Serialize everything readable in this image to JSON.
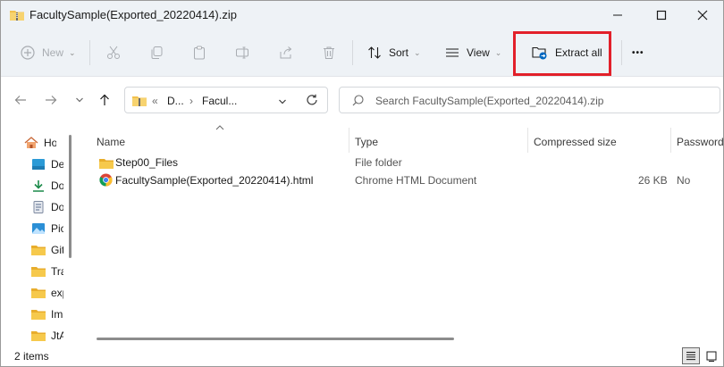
{
  "window": {
    "title": "FacultySample(Exported_20220414).zip"
  },
  "toolbar": {
    "new_label": "New",
    "sort_label": "Sort",
    "view_label": "View",
    "extract_label": "Extract all",
    "more_label": "•••"
  },
  "address": {
    "overflow": "«",
    "crumbs": [
      "D...",
      "Facul..."
    ]
  },
  "search": {
    "placeholder": "Search FacultySample(Exported_20220414).zip"
  },
  "sidebar": {
    "items": [
      {
        "label": "Home",
        "icon": "home-icon"
      },
      {
        "label": "Desktop",
        "icon": "desktop-icon"
      },
      {
        "label": "Downloads",
        "icon": "download-icon"
      },
      {
        "label": "Documents",
        "icon": "document-icon"
      },
      {
        "label": "Pictures",
        "icon": "pictures-icon"
      },
      {
        "label": "GitHub",
        "icon": "folder-icon"
      },
      {
        "label": "Travel",
        "icon": "folder-icon"
      },
      {
        "label": "export",
        "icon": "folder-icon"
      },
      {
        "label": "Images",
        "icon": "folder-icon"
      },
      {
        "label": "JtAlt",
        "icon": "folder-icon"
      }
    ]
  },
  "columns": {
    "name": "Name",
    "type": "Type",
    "compressed": "Compressed size",
    "password": "Password"
  },
  "files": [
    {
      "name": "Step00_Files",
      "type": "File folder",
      "size": "",
      "password": "",
      "icon": "folder-icon"
    },
    {
      "name": "FacultySample(Exported_20220414).html",
      "type": "Chrome HTML Document",
      "size": "26 KB",
      "password": "No",
      "icon": "chrome-icon"
    }
  ],
  "status": {
    "count": "2 items"
  },
  "colors": {
    "accent": "#0067c0",
    "highlight": "#e2202a",
    "folder": "#f2c14e"
  }
}
